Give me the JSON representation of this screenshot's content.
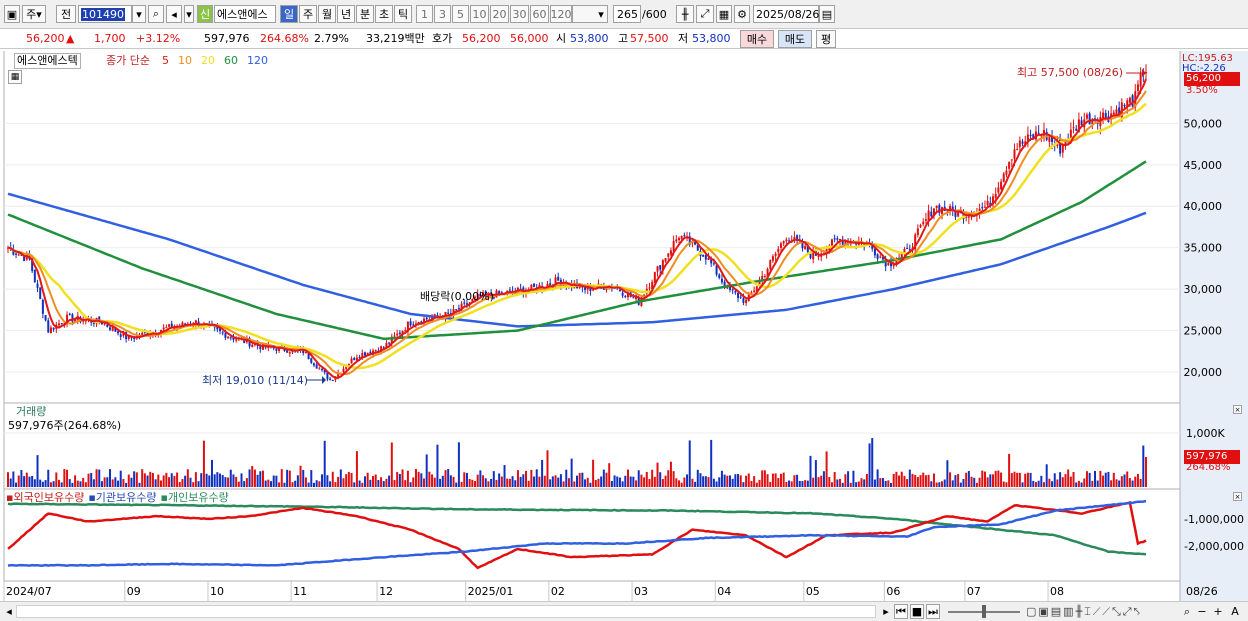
{
  "toolbar": {
    "market": "주",
    "prev_label": "전",
    "code": "101490",
    "stock_name": "에스앤에스",
    "credit": "신",
    "periods": [
      "일",
      "주",
      "월",
      "년",
      "분",
      "초",
      "틱"
    ],
    "intervals": [
      "1",
      "3",
      "5",
      "10",
      "20",
      "30",
      "60",
      "120"
    ],
    "count": "265",
    "count_max": "/600",
    "date": "2025/08/26"
  },
  "quote": {
    "price": "56,200",
    "change": "1,700",
    "change_pct": "+3.12%",
    "volume": "597,976",
    "volume_ratio": "264.68%",
    "turnover": "2.79%",
    "amount": "33,219백만",
    "bid_label": "호가",
    "bid1": "56,200",
    "bid2": "56,000",
    "open_label": "시",
    "open": "53,800",
    "high_label": "고",
    "high": "57,500",
    "low_label": "저",
    "low": "53,800",
    "buy": "매수",
    "sell": "매도",
    "avg": "평"
  },
  "price_panel": {
    "legend_name": "에스앤에스텍",
    "legend_type": "종가 단순",
    "ma_labels": [
      "5",
      "10",
      "20",
      "60",
      "120"
    ],
    "lc": "LC:195.63",
    "hc": "HC:-2.26",
    "cur_price": "56,200",
    "cur_pct": "3.50%",
    "high_note": "최고 57,500 (08/26)",
    "low_note": "최저 19,010 (11/14)",
    "div_note": "배당락(0.00%)",
    "y_ticks": [
      "50,000",
      "45,000",
      "40,000",
      "35,000",
      "30,000",
      "25,000",
      "20,000"
    ]
  },
  "volume_panel": {
    "title": "거래량",
    "value": "597,976주(264.68%)",
    "tick": "1,000K",
    "cur": "597,976",
    "cur_pct": "264.68%"
  },
  "holding_panel": {
    "legends": [
      "외국인보유수량",
      "기관보유수량",
      "개인보유수량"
    ],
    "ticks": [
      "-1,000,000",
      "-2,000,000"
    ]
  },
  "x_labels": [
    "2024/07",
    "09",
    "10",
    "11",
    "12",
    "2025/01",
    "02",
    "03",
    "04",
    "05",
    "06",
    "07",
    "08"
  ],
  "x_right": "08/26",
  "colors": {
    "up": "#e01010",
    "down": "#1030c0",
    "ma5": "#e01818",
    "ma10": "#f08c20",
    "ma20": "#f0e020",
    "ma60": "#20903c",
    "ma120": "#3060e0"
  },
  "chart_data": {
    "type": "line",
    "x_start": "2024/07",
    "x_end": "2025/08/26",
    "ylim": [
      16500,
      58000
    ],
    "key_points": [
      {
        "x": 0,
        "y": 35000
      },
      {
        "x": 8,
        "y": 33500
      },
      {
        "x": 15,
        "y": 25000
      },
      {
        "x": 22,
        "y": 26500
      },
      {
        "x": 35,
        "y": 26000
      },
      {
        "x": 45,
        "y": 24000
      },
      {
        "x": 55,
        "y": 25000
      },
      {
        "x": 70,
        "y": 26000
      },
      {
        "x": 85,
        "y": 24000
      },
      {
        "x": 95,
        "y": 23000
      },
      {
        "x": 110,
        "y": 22500
      },
      {
        "x": 120,
        "y": 19010
      },
      {
        "x": 130,
        "y": 22000
      },
      {
        "x": 140,
        "y": 23000
      },
      {
        "x": 150,
        "y": 26000
      },
      {
        "x": 165,
        "y": 27000
      },
      {
        "x": 175,
        "y": 29000
      },
      {
        "x": 185,
        "y": 29500
      },
      {
        "x": 195,
        "y": 30000
      },
      {
        "x": 205,
        "y": 31000
      },
      {
        "x": 215,
        "y": 30000
      },
      {
        "x": 225,
        "y": 30500
      },
      {
        "x": 235,
        "y": 28500
      },
      {
        "x": 245,
        "y": 34000
      },
      {
        "x": 250,
        "y": 36500
      },
      {
        "x": 260,
        "y": 34000
      },
      {
        "x": 268,
        "y": 30000
      },
      {
        "x": 275,
        "y": 28500
      },
      {
        "x": 282,
        "y": 32000
      },
      {
        "x": 290,
        "y": 36500
      },
      {
        "x": 300,
        "y": 34000
      },
      {
        "x": 310,
        "y": 36000
      },
      {
        "x": 320,
        "y": 35500
      },
      {
        "x": 328,
        "y": 33000
      },
      {
        "x": 335,
        "y": 34500
      },
      {
        "x": 345,
        "y": 40000
      },
      {
        "x": 355,
        "y": 39000
      },
      {
        "x": 365,
        "y": 40000
      },
      {
        "x": 375,
        "y": 47000
      },
      {
        "x": 385,
        "y": 49000
      },
      {
        "x": 392,
        "y": 47000
      },
      {
        "x": 400,
        "y": 50500
      },
      {
        "x": 410,
        "y": 51000
      },
      {
        "x": 420,
        "y": 53000
      },
      {
        "x": 424,
        "y": 57500
      }
    ],
    "ma60_points": [
      {
        "x": 0,
        "y": 39000
      },
      {
        "x": 50,
        "y": 32500
      },
      {
        "x": 100,
        "y": 27000
      },
      {
        "x": 140,
        "y": 24000
      },
      {
        "x": 190,
        "y": 25000
      },
      {
        "x": 235,
        "y": 28500
      },
      {
        "x": 280,
        "y": 31000
      },
      {
        "x": 330,
        "y": 33500
      },
      {
        "x": 370,
        "y": 36000
      },
      {
        "x": 400,
        "y": 40500
      },
      {
        "x": 424,
        "y": 45400
      }
    ],
    "ma120_points": [
      {
        "x": 0,
        "y": 41500
      },
      {
        "x": 60,
        "y": 36000
      },
      {
        "x": 110,
        "y": 30500
      },
      {
        "x": 150,
        "y": 27000
      },
      {
        "x": 190,
        "y": 25500
      },
      {
        "x": 240,
        "y": 26000
      },
      {
        "x": 290,
        "y": 27500
      },
      {
        "x": 330,
        "y": 30000
      },
      {
        "x": 370,
        "y": 33000
      },
      {
        "x": 410,
        "y": 37500
      },
      {
        "x": 424,
        "y": 39200
      }
    ]
  }
}
